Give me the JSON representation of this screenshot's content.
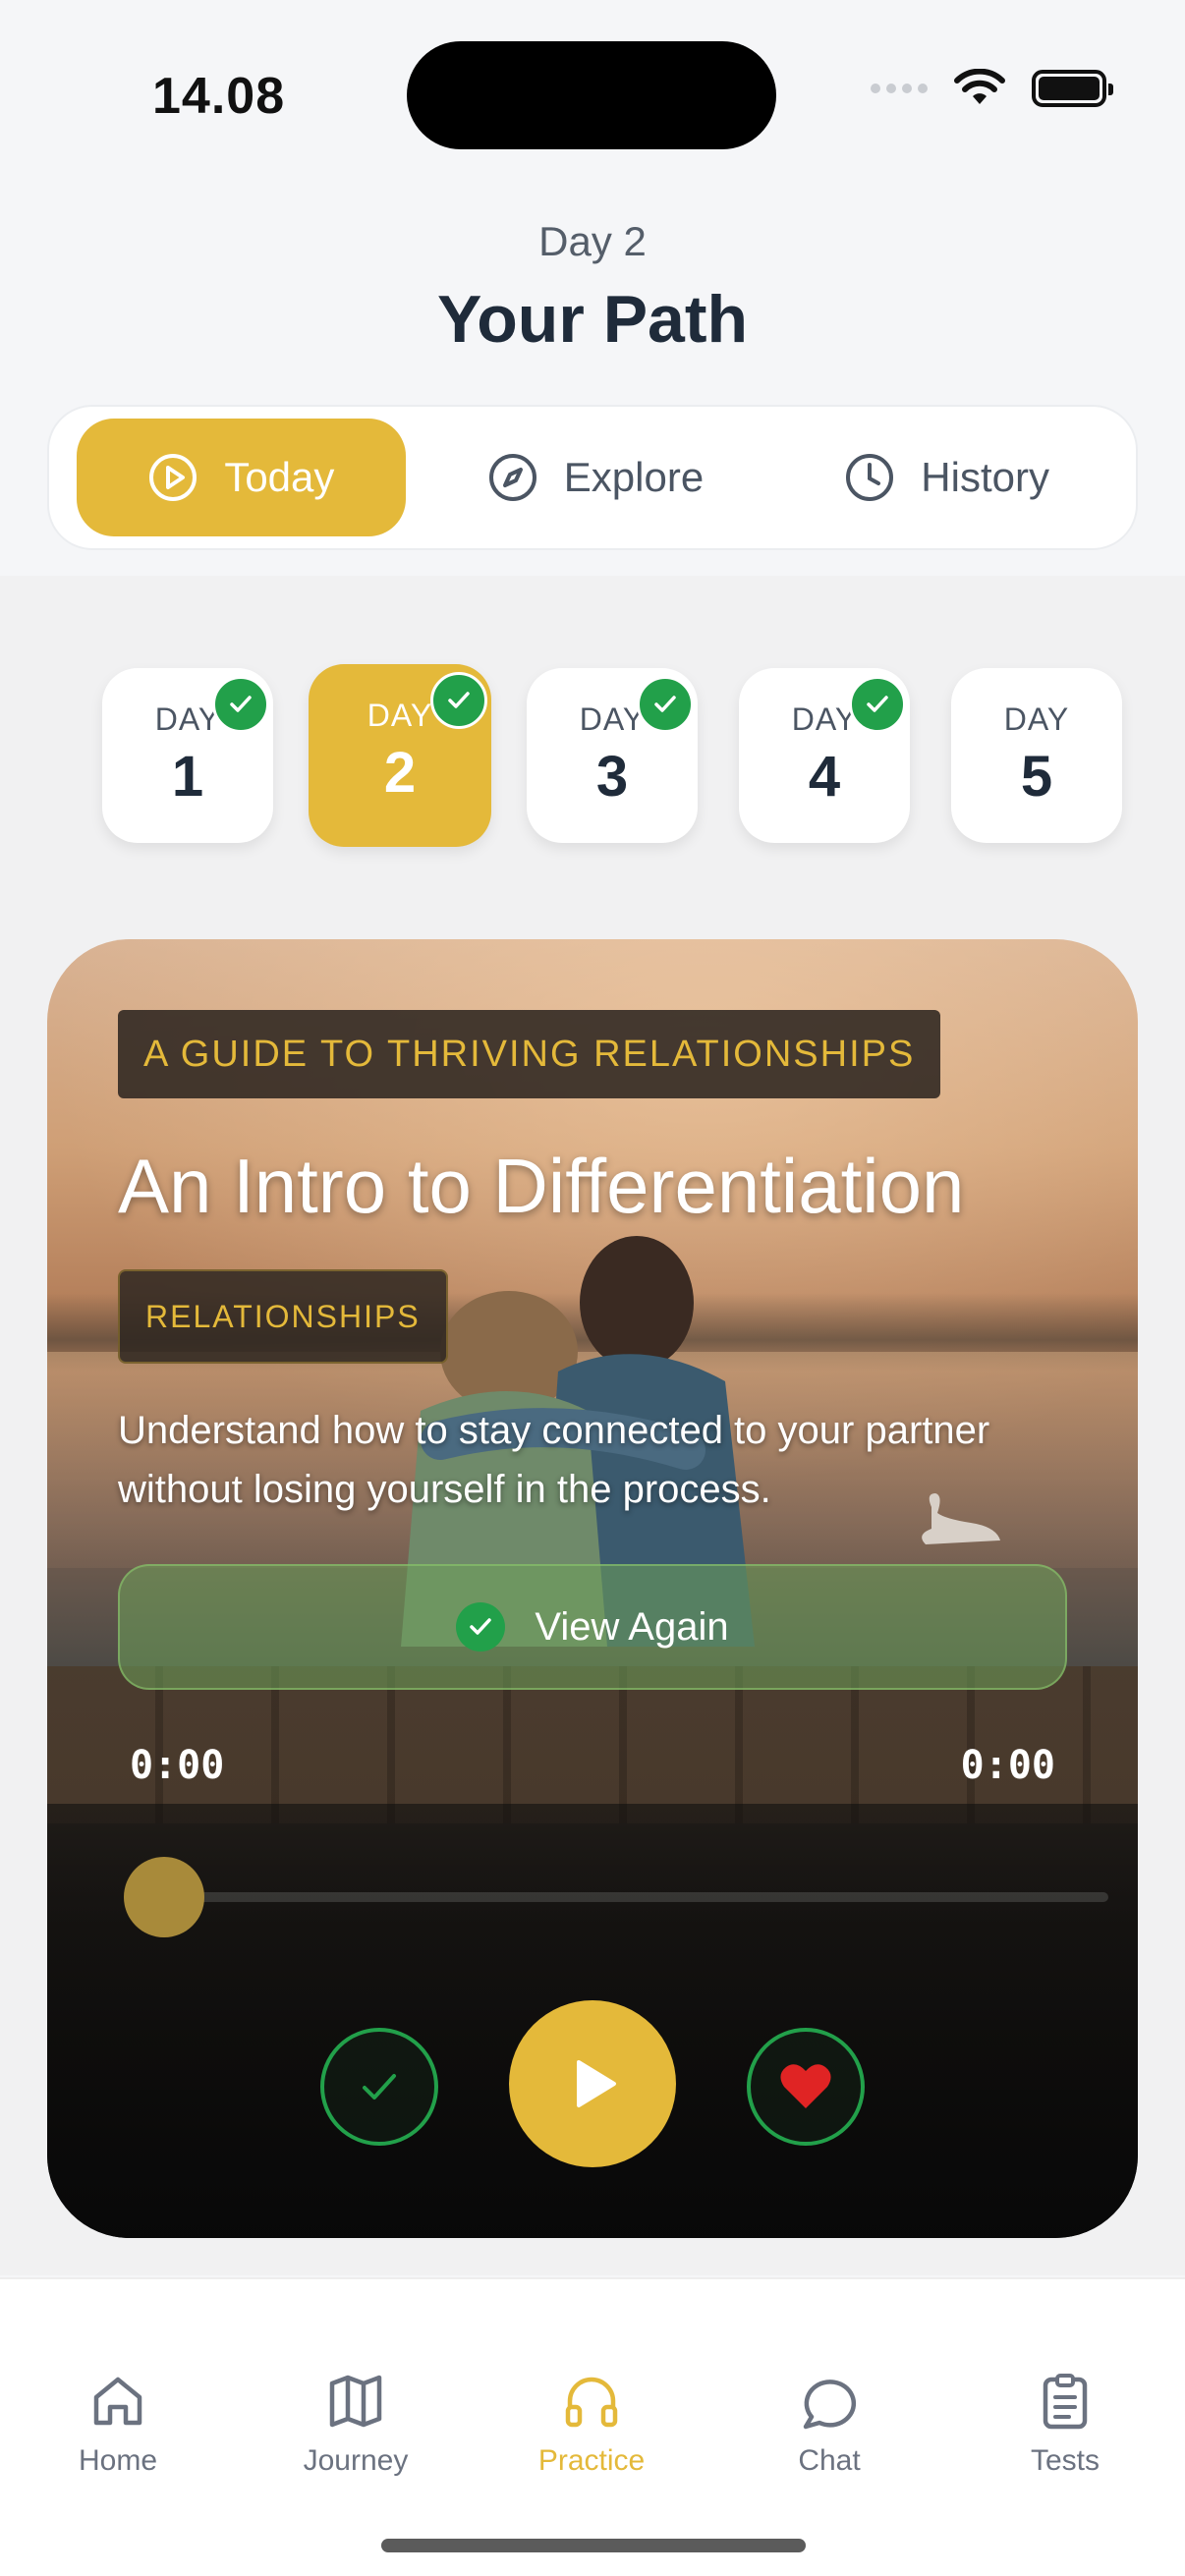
{
  "status_bar": {
    "time": "14.08"
  },
  "header": {
    "subheading": "Day 2",
    "title": "Your Path"
  },
  "tabs": [
    {
      "label": "Today",
      "icon": "play-circle-icon",
      "active": true
    },
    {
      "label": "Explore",
      "icon": "compass-icon",
      "active": false
    },
    {
      "label": "History",
      "icon": "clock-icon",
      "active": false
    }
  ],
  "days": [
    {
      "label": "DAY",
      "number": "1",
      "completed": true,
      "active": false
    },
    {
      "label": "DAY",
      "number": "2",
      "completed": true,
      "active": true
    },
    {
      "label": "DAY",
      "number": "3",
      "completed": true,
      "active": false
    },
    {
      "label": "DAY",
      "number": "4",
      "completed": true,
      "active": false
    },
    {
      "label": "DAY",
      "number": "5",
      "completed": false,
      "active": false
    }
  ],
  "card": {
    "series": "A GUIDE TO THRIVING RELATIONSHIPS",
    "title": "An Intro to Differentiation",
    "category": "RELATIONSHIPS",
    "description": "Understand how to stay connected to your partner without losing yourself in the process.",
    "view_again_label": "View Again",
    "time_start": "0:00",
    "time_end": "0:00",
    "progress": 0
  },
  "nav": [
    {
      "label": "Home",
      "icon": "home-icon",
      "active": false
    },
    {
      "label": "Journey",
      "icon": "map-icon",
      "active": false
    },
    {
      "label": "Practice",
      "icon": "headphones-icon",
      "active": true
    },
    {
      "label": "Chat",
      "icon": "chat-bubble-icon",
      "active": false
    },
    {
      "label": "Tests",
      "icon": "clipboard-icon",
      "active": false
    }
  ],
  "colors": {
    "accent": "#e4b93a",
    "success": "#22a04a",
    "heart": "#e02424",
    "text": "#1f2b3a"
  }
}
